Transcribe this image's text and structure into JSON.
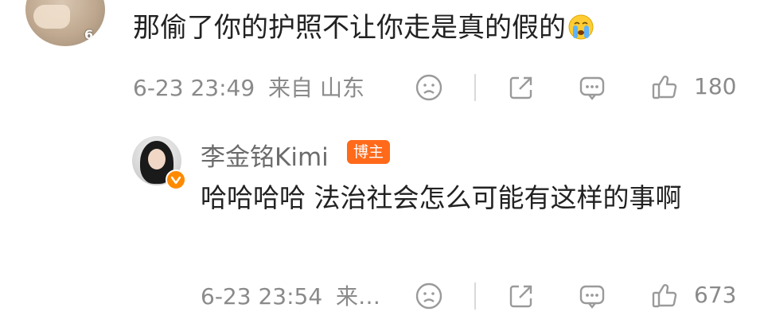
{
  "comment": {
    "avatar_badge": "6",
    "text": "那偷了你的护照不让你走是真的假的",
    "emoji": "crying-face-emoji",
    "time": "6-23 23:49",
    "location": "来自 山东",
    "likes": "180"
  },
  "reply": {
    "author": "李金铭Kimi",
    "owner_badge": "博主",
    "text": "哈哈哈哈 法治社会怎么可能有这样的事啊",
    "time": "6-23 23:54",
    "location": "来…",
    "likes": "673"
  },
  "colors": {
    "badge_orange": "#ff6a1a",
    "verified_orange": "#ff8a00",
    "meta_gray": "#8a8a8a",
    "icon_gray": "#9a9a9a"
  }
}
